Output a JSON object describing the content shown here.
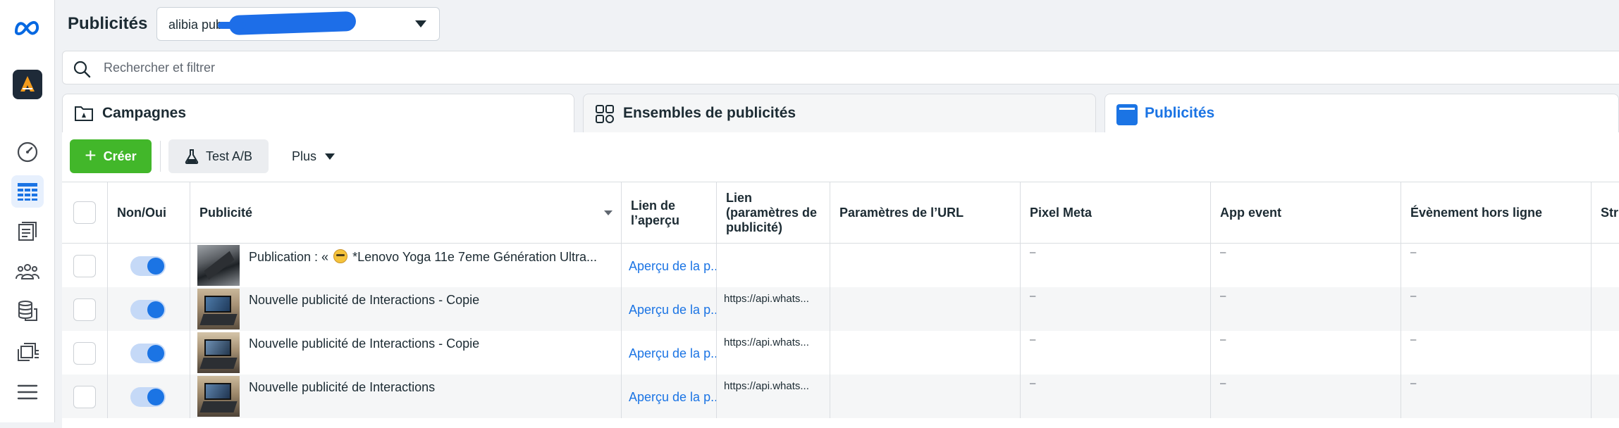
{
  "header": {
    "title": "Publicités",
    "account_prefix": "alibia pub"
  },
  "search": {
    "placeholder": "Rechercher et filtrer"
  },
  "tabs": [
    {
      "label": "Campagnes",
      "icon": "folder-icon"
    },
    {
      "label": "Ensembles de publicités",
      "icon": "grid-icon"
    },
    {
      "label": "Publicités",
      "icon": "ad-icon",
      "active": true
    }
  ],
  "toolbar": {
    "create_label": "Créer",
    "ab_label": "Test A/B",
    "more_label": "Plus"
  },
  "columns": {
    "toggle": "Non/Oui",
    "ad": "Publicité",
    "preview_link": "Lien de l’aperçu",
    "link_params": "Lien (paramètres de publicité)",
    "url_params": "Paramètres de l’URL",
    "pixel": "Pixel Meta",
    "app_event": "App event",
    "offline_event": "Évènement hors ligne",
    "str": "Str"
  },
  "rows": [
    {
      "name_prefix": "Publication : «",
      "name_suffix": "*Lenovo Yoga 11e 7eme Génération Ultra...",
      "preview": "Aperçu de la p...",
      "link_params": "",
      "pixel": "–",
      "app_event": "–",
      "offline": "–",
      "active": true
    },
    {
      "name": "Nouvelle publicité de Interactions - Copie",
      "preview": "Aperçu de la p...",
      "link_params": "https://api.whats...",
      "pixel": "–",
      "app_event": "–",
      "offline": "–",
      "active": true
    },
    {
      "name": "Nouvelle publicité de Interactions - Copie",
      "preview": "Aperçu de la p...",
      "link_params": "https://api.whats...",
      "pixel": "–",
      "app_event": "–",
      "offline": "–",
      "active": true
    },
    {
      "name": "Nouvelle publicité de Interactions",
      "preview": "Aperçu de la p...",
      "link_params": "https://api.whats...",
      "pixel": "–",
      "app_event": "–",
      "offline": "–",
      "active": true
    }
  ],
  "colors": {
    "accent": "#1b74e4",
    "create": "#42b72a",
    "meta_blue": "#0668e1"
  },
  "rail_icons": [
    "meta-logo-icon",
    "account-avatar-icon",
    "dashboard-icon",
    "table-icon",
    "reports-icon",
    "audiences-icon",
    "database-icon",
    "catalog-icon",
    "menu-icon"
  ]
}
